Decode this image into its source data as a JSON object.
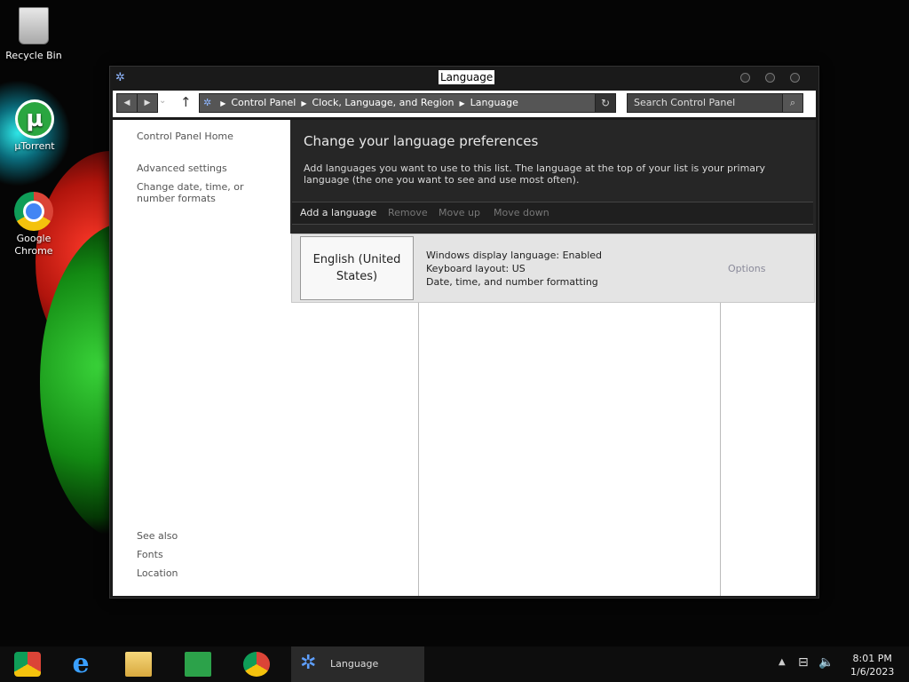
{
  "desktop": {
    "icons": [
      {
        "label": "Recycle Bin"
      },
      {
        "label": "µTorrent"
      },
      {
        "label": "Google Chrome"
      }
    ]
  },
  "window": {
    "title": "Language",
    "breadcrumb": [
      "Control Panel",
      "Clock, Language, and Region",
      "Language"
    ],
    "search_placeholder": "Search Control Panel",
    "sidebar": {
      "links": [
        "Control Panel Home",
        "Advanced settings",
        "Change date, time, or number formats"
      ],
      "see_also_title": "See also",
      "see_also": [
        "Fonts",
        "Location"
      ]
    },
    "main": {
      "heading": "Change your language preferences",
      "description": "Add languages you want to use to this list. The language at the top of your list is your primary language (the one you want to see and use most often).",
      "toolbar": {
        "add": "Add a language",
        "remove": "Remove",
        "move_up": "Move up",
        "move_down": "Move down"
      },
      "languages": [
        {
          "name": "English (United States)",
          "details": [
            "Windows display language: Enabled",
            "Keyboard layout: US",
            "Date, time, and number formatting"
          ],
          "options": "Options"
        }
      ]
    }
  },
  "taskbar": {
    "pinned": [
      "chrome-alt",
      "internet-explorer",
      "file-explorer",
      "store",
      "chrome"
    ],
    "active_window": "Language",
    "time": "8:01 PM",
    "date": "1/6/2023"
  },
  "colors": {
    "accent_link": "#555555",
    "header_bg": "#262626",
    "toolbar_disabled": "#777777"
  }
}
